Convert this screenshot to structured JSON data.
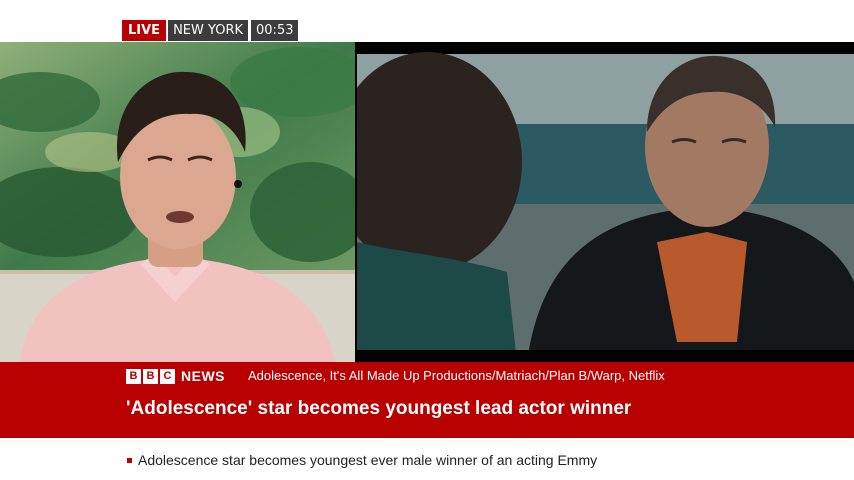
{
  "live_badge": {
    "live": "LIVE",
    "location": "NEW YORK",
    "time": "00:53"
  },
  "video": {
    "left_panel": "presenter-remote-feed",
    "right_panel": "drama-clip"
  },
  "lower_third": {
    "brand_blocks": [
      "B",
      "B",
      "C"
    ],
    "brand_word": "NEWS",
    "credit": "Adolescence, It's All Made Up Productions/Matriach/Plan B/Warp, Netflix",
    "headline": "'Adolescence' star becomes youngest lead actor winner"
  },
  "ticker": {
    "text": "Adolescence star becomes youngest ever male winner of an acting Emmy"
  },
  "colors": {
    "bbc_red": "#b80000",
    "badge_grey": "#3c3c3c"
  }
}
